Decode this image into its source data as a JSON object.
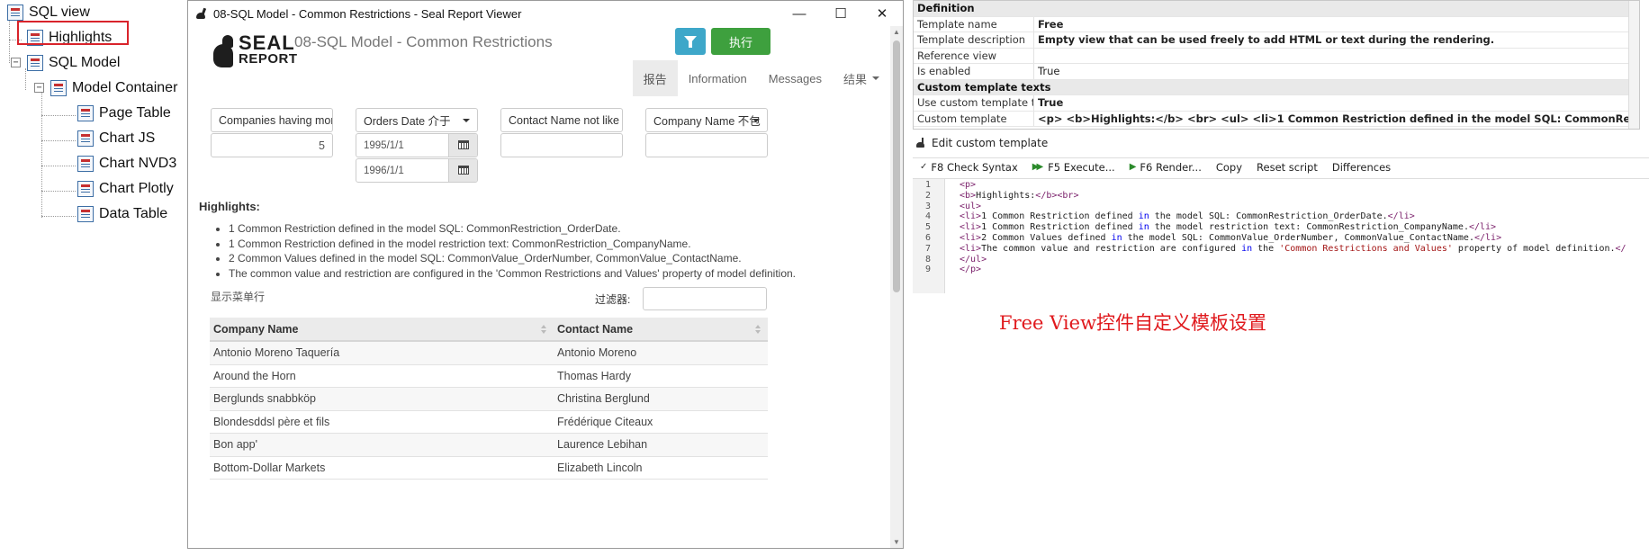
{
  "tree": {
    "root": "SQL view",
    "highlights": "Highlights",
    "sql_model": "SQL Model",
    "model_container": "Model Container",
    "page_table": "Page Table",
    "chart_js": "Chart JS",
    "chart_nvd3": "Chart NVD3",
    "chart_plotly": "Chart Plotly",
    "data_table": "Data Table"
  },
  "viewer": {
    "window_title": "08-SQL Model - Common Restrictions - Seal Report Viewer",
    "minimize": "—",
    "maximize": "☐",
    "close": "✕",
    "logo_line1": "SEAL",
    "logo_line2": "REPORT",
    "report_title": "08-SQL Model - Common Restrictions",
    "execute_label": "执行",
    "tabs": [
      "报告",
      "Information",
      "Messages",
      "结果"
    ],
    "restrictions": {
      "r1_label": "Companies having more",
      "r1_value": "5",
      "r2_label": "Orders Date 介于",
      "r2_from": "1995/1/1",
      "r2_to": "1996/1/1",
      "r3_label": "Contact Name not like",
      "r4_label": "Company Name 不包"
    },
    "highlights_title": "Highlights:",
    "highlights": [
      "1 Common Restriction defined in the model SQL: CommonRestriction_OrderDate.",
      "1 Common Restriction defined in the model restriction text: CommonRestriction_CompanyName.",
      "2 Common Values defined in the model SQL: CommonValue_OrderNumber, CommonValue_ContactName.",
      "The common value and restriction are configured in the 'Common Restrictions and Values' property of model definition."
    ],
    "table_caption": "显示菜单行",
    "filter_label": "过滤器:",
    "table": {
      "headers": [
        "Company Name",
        "Contact Name"
      ],
      "rows": [
        [
          "Antonio Moreno Taquería",
          "Antonio Moreno"
        ],
        [
          "Around the Horn",
          "Thomas Hardy"
        ],
        [
          "Berglunds snabbköp",
          "Christina Berglund"
        ],
        [
          "Blondesddsl père et fils",
          "Frédérique Citeaux"
        ],
        [
          "Bon app'",
          "Laurence Lebihan"
        ],
        [
          "Bottom-Dollar Markets",
          "Elizabeth Lincoln"
        ]
      ]
    }
  },
  "properties": {
    "cat_definition": "Definition",
    "template_name_label": "Template name",
    "template_name": "Free",
    "template_desc_label": "Template description",
    "template_desc": "Empty view that can be used freely to add HTML or text during the rendering.",
    "reference_view_label": "Reference view",
    "reference_view": "",
    "is_enabled_label": "Is enabled",
    "is_enabled": "True",
    "cat_custom": "Custom template texts",
    "use_custom_label": "Use custom template tex",
    "use_custom": "True",
    "custom_template_label": "Custom template",
    "custom_template": "<p> <b>Highlights:</b> <br> <ul> <li>1 Common Restriction defined in the model SQL: CommonRestriction_OrderDate.</li"
  },
  "editor": {
    "title": "Edit custom template",
    "toolbar": {
      "check": "F8 Check Syntax",
      "execute": "F5 Execute...",
      "render": "F6 Render...",
      "copy": "Copy",
      "reset": "Reset script",
      "differences": "Differences"
    },
    "line_numbers": [
      "1",
      "2",
      "3",
      "4",
      "5",
      "6",
      "7",
      "8",
      "9"
    ],
    "lines": [
      "<p>",
      "<b>Highlights:</b><br>",
      "<ul>",
      "<li>1 Common Restriction defined in the model SQL: CommonRestriction_OrderDate.</li>",
      "<li>1 Common Restriction defined in the model restriction text: CommonRestriction_CompanyName.</li>",
      "<li>2 Common Values defined in the model SQL: CommonValue_OrderNumber, CommonValue_ContactName.</li>",
      "<li>The common value and restriction are configured in the 'Common Restrictions and Values' property of model definition.</",
      "</ul>",
      "</p>"
    ]
  },
  "annotation": "Free View控件自定义模板设置",
  "colors": {
    "accent_red": "#d9232b",
    "filter_button": "#3ea7c9",
    "execute_button": "#3ea03e",
    "annotation": "#e0191d"
  }
}
